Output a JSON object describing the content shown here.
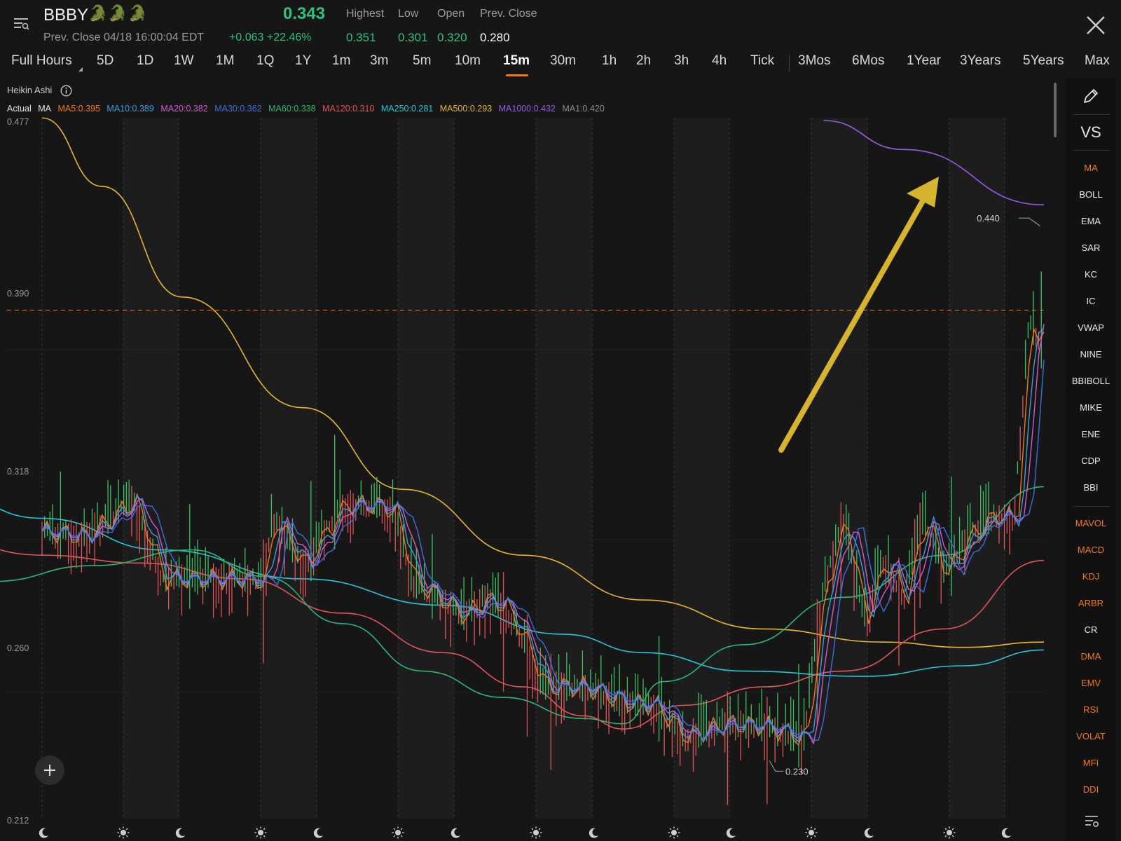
{
  "header": {
    "ticker": "BBBY",
    "emoji": "🐊🐊🐊",
    "prev_close_line": "Prev. Close 04/18 16:00:04 EDT",
    "price": "0.343",
    "change_abs": "+0.063",
    "change_pct": "+22.46%",
    "stats": [
      {
        "label": "Highest",
        "value": "0.351",
        "color": "#2ec27e"
      },
      {
        "label": "Low",
        "value": "0.301",
        "color": "#2ec27e"
      },
      {
        "label": "Open",
        "value": "0.320",
        "color": "#2ec27e"
      },
      {
        "label": "Prev. Close",
        "value": "0.280",
        "color": "#ffffff"
      }
    ]
  },
  "tabs": [
    {
      "label": "Full Hours"
    },
    {
      "label": "5D"
    },
    {
      "label": "1D"
    },
    {
      "label": "1W"
    },
    {
      "label": "1M"
    },
    {
      "label": "1Q"
    },
    {
      "label": "1Y"
    },
    {
      "label": "1m"
    },
    {
      "label": "3m"
    },
    {
      "label": "5m"
    },
    {
      "label": "10m"
    },
    {
      "label": "15m",
      "active": true
    },
    {
      "label": "30m"
    },
    {
      "label": "1h"
    },
    {
      "label": "2h"
    },
    {
      "label": "3h"
    },
    {
      "label": "4h"
    },
    {
      "label": "Tick"
    },
    {
      "label": "3Mos"
    },
    {
      "label": "6Mos"
    },
    {
      "label": "1Year"
    },
    {
      "label": "3Years"
    },
    {
      "label": "5Years"
    },
    {
      "label": "Max"
    }
  ],
  "chart_header": {
    "type_label": "Heikin Ashi",
    "legend_prefix": "Actual",
    "ma_label": "MA",
    "ma_entries": [
      {
        "label": "MA5:0.395",
        "color": "#f07a1a"
      },
      {
        "label": "MA10:0.389",
        "color": "#3a9fe0"
      },
      {
        "label": "MA20:0.382",
        "color": "#d45ad0"
      },
      {
        "label": "MA30:0.362",
        "color": "#3d6fe0"
      },
      {
        "label": "MA60:0.338",
        "color": "#2bb673"
      },
      {
        "label": "MA120:0.310",
        "color": "#e0565a"
      },
      {
        "label": "MA250:0.281",
        "color": "#27c7d6"
      },
      {
        "label": "MA500:0.293",
        "color": "#e6b630"
      },
      {
        "label": "MA1000:0.432",
        "color": "#9b5ae6"
      },
      {
        "label": "MA1:0.420",
        "color": "#8c8c8c"
      }
    ]
  },
  "chart_data": {
    "type": "line",
    "y_ticks": [
      "0.477",
      "0.390",
      "0.318",
      "0.260",
      "0.212"
    ],
    "ylim": [
      0.212,
      0.477
    ],
    "current_price_line": 0.405,
    "annotations": [
      {
        "label": "0.440",
        "kind": "high"
      },
      {
        "label": "0.230",
        "kind": "low"
      }
    ],
    "series": [
      {
        "name": "MA500",
        "color": "#e6b630",
        "points": [
          [
            0,
            0.478
          ],
          [
            0.06,
            0.452
          ],
          [
            0.14,
            0.41
          ],
          [
            0.26,
            0.368
          ],
          [
            0.36,
            0.337
          ],
          [
            0.48,
            0.312
          ],
          [
            0.6,
            0.295
          ],
          [
            0.72,
            0.284
          ],
          [
            0.84,
            0.279
          ],
          [
            0.92,
            0.277
          ],
          [
            1.0,
            0.279
          ]
        ]
      },
      {
        "name": "MA250",
        "color": "#27c7d6",
        "points": [
          [
            -0.31,
            0.38
          ],
          [
            -0.25,
            0.36
          ],
          [
            -0.2,
            0.349
          ],
          [
            -0.1,
            0.336
          ],
          [
            0.0,
            0.326
          ],
          [
            0.12,
            0.314
          ],
          [
            0.26,
            0.303
          ],
          [
            0.4,
            0.293
          ],
          [
            0.52,
            0.282
          ],
          [
            0.6,
            0.275
          ],
          [
            0.7,
            0.268
          ],
          [
            0.82,
            0.266
          ],
          [
            0.92,
            0.27
          ],
          [
            1.0,
            0.276
          ]
        ]
      },
      {
        "name": "MA120",
        "color": "#e0565a",
        "points": [
          [
            -0.31,
            0.34
          ],
          [
            -0.15,
            0.327
          ],
          [
            0.0,
            0.312
          ],
          [
            0.1,
            0.309
          ],
          [
            0.2,
            0.303
          ],
          [
            0.3,
            0.29
          ],
          [
            0.4,
            0.275
          ],
          [
            0.48,
            0.262
          ],
          [
            0.54,
            0.251
          ],
          [
            0.58,
            0.246
          ],
          [
            0.64,
            0.255
          ],
          [
            0.72,
            0.262
          ],
          [
            0.8,
            0.268
          ],
          [
            0.9,
            0.284
          ],
          [
            1.0,
            0.31
          ]
        ]
      },
      {
        "name": "MA60",
        "color": "#2bb673",
        "points": [
          [
            -0.31,
            0.33
          ],
          [
            -0.22,
            0.313
          ],
          [
            -0.15,
            0.306
          ],
          [
            -0.05,
            0.302
          ],
          [
            0.05,
            0.308
          ],
          [
            0.15,
            0.314
          ],
          [
            0.22,
            0.304
          ],
          [
            0.3,
            0.286
          ],
          [
            0.38,
            0.268
          ],
          [
            0.46,
            0.258
          ],
          [
            0.54,
            0.25
          ],
          [
            0.58,
            0.248
          ],
          [
            0.62,
            0.264
          ],
          [
            0.7,
            0.278
          ],
          [
            0.8,
            0.296
          ],
          [
            0.9,
            0.312
          ],
          [
            1.0,
            0.338
          ]
        ]
      },
      {
        "name": "MA1000",
        "color": "#9b5ae6",
        "points": [
          [
            0.78,
            0.477
          ],
          [
            0.86,
            0.466
          ],
          [
            1.0,
            0.445
          ]
        ]
      }
    ]
  },
  "right_panel": {
    "main": [
      "MA",
      "BOLL",
      "EMA",
      "SAR",
      "KC",
      "IC",
      "VWAP",
      "NINE",
      "BBIBOLL",
      "MIKE",
      "ENE",
      "CDP",
      "BBI"
    ],
    "sub": [
      "MAVOL",
      "MACD",
      "KDJ",
      "ARBR",
      "CR",
      "DMA",
      "EMV",
      "RSI",
      "VOLAT",
      "MFI",
      "DDI"
    ],
    "highlighted_main": "MA",
    "vs_label": "VS"
  }
}
